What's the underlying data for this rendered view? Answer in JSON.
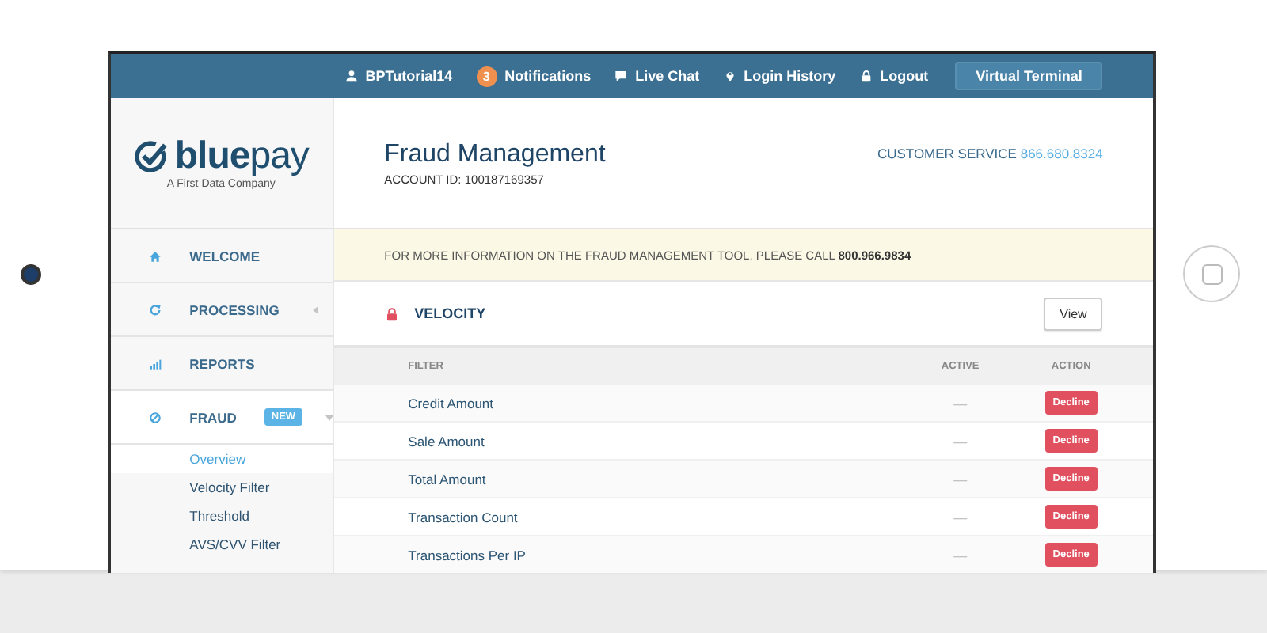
{
  "topbar": {
    "items": [
      {
        "kind": "user",
        "label": "BPTutorial14"
      },
      {
        "kind": "notifications",
        "label": "Notifications",
        "badge": "3"
      },
      {
        "kind": "chat",
        "label": "Live Chat"
      },
      {
        "kind": "location",
        "label": "Login History"
      },
      {
        "kind": "lock",
        "label": "Logout"
      }
    ],
    "button": "Virtual Terminal"
  },
  "sidebar": {
    "logo": {
      "wordmark": "**blue**pay",
      "tagline": "A First Data Company"
    },
    "nav": [
      {
        "kind": "link",
        "label": "WELCOME"
      },
      {
        "kind": "menu",
        "label": "PROCESSING",
        "expanded": false
      },
      {
        "kind": "link",
        "label": "REPORTS"
      },
      {
        "kind": "menu",
        "label": "FRAUD",
        "badge": "NEW",
        "expanded": true,
        "children": [
          {
            "label": "Overview",
            "selected": true
          },
          {
            "label": "Velocity Filter",
            "selected": false
          },
          {
            "label": "Threshold",
            "selected": false
          },
          {
            "label": "AVS/CVV Filter",
            "selected": false
          }
        ]
      }
    ]
  },
  "header": {
    "title": "Fraud Management",
    "account": "ACCOUNT ID: 100187169357",
    "service_label": "CUSTOMER SERVICE",
    "service_phone": "866.680.8324"
  },
  "notice": "FOR MORE INFORMATION ON THE FRAUD MANAGEMENT TOOL, PLEASE CALL **800.966.9834**",
  "section": {
    "title": "VELOCITY",
    "button": "View"
  },
  "table": {
    "columns": [
      "FILTER",
      "ACTIVE",
      "ACTION"
    ],
    "rows": [
      {
        "filter": "Credit Amount",
        "active": "—",
        "action": "Decline"
      },
      {
        "filter": "Sale Amount",
        "active": "—",
        "action": "Decline"
      },
      {
        "filter": "Total Amount",
        "active": "—",
        "action": "Decline"
      },
      {
        "filter": "Transaction Count",
        "active": "—",
        "action": "Decline"
      },
      {
        "filter": "Transactions Per IP",
        "active": "—",
        "action": "Decline"
      }
    ]
  }
}
